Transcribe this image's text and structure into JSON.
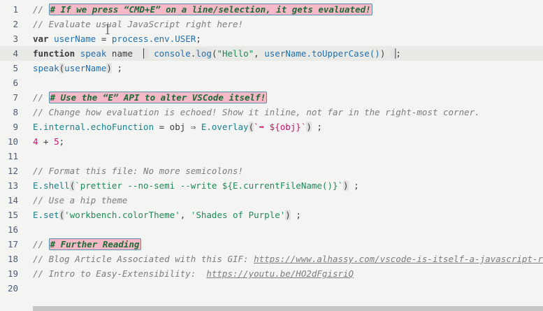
{
  "line_numbers": [
    "1",
    "2",
    "3",
    "4",
    "5",
    "6",
    "7",
    "8",
    "9",
    "10",
    "11",
    "12",
    "13",
    "14",
    "15",
    "16",
    "17",
    "18",
    "19",
    "20"
  ],
  "lines": {
    "l1": {
      "prefix": "// ",
      "heading": "# If we press “CMD+E” on a line/selection, it gets evaluated!"
    },
    "l2": {
      "text": "// Evaluate usual JavaScript right here!"
    },
    "l3": {
      "kw": "var",
      "name": "userName",
      "op": " = ",
      "proc": "process.env.USER",
      "end": ";"
    },
    "l4": {
      "kw": "function",
      "fn": "speak",
      "param": "name",
      "obj": "console",
      "method": "log",
      "arg1": "\"Hello\"",
      "arg2": "userName.toUpperCase()",
      "end": ";"
    },
    "l5": {
      "fn": "speak",
      "arg": "userName",
      "end": ";"
    },
    "l7": {
      "prefix": "// ",
      "heading": "# Use the “E” API to alter VSCode itself!"
    },
    "l8": {
      "text": "// Change how evaluation is echoed! Show it inline, not far in the right-most corner."
    },
    "l9": {
      "a": "E.internal.echoFunction",
      "b": " = obj ⇒ ",
      "c": "E.overlay",
      "d": "`➡ ${obj}`",
      "end": ";"
    },
    "l10": {
      "a": "4",
      "op": " + ",
      "b": "5",
      "end": ";"
    },
    "l12": {
      "text": "// Format this file: No more semicolons!"
    },
    "l13": {
      "a": "E.shell",
      "b": "`prettier --no-semi --write ${E.currentFileName()}`",
      "end": ";"
    },
    "l14": {
      "text": "// Use a hip theme"
    },
    "l15": {
      "a": "E.set",
      "b": "'workbench.colorTheme'",
      "c": ", ",
      "d": "'Shades of Purple'",
      "end": ";"
    },
    "l17": {
      "prefix": "// ",
      "heading": "# Further Reading"
    },
    "l18": {
      "prefix": "// Blog Article Associated with this GIF: ",
      "url": "https://www.alhassy.com/vscode-is-itself-a-javascript-repl"
    },
    "l19": {
      "prefix": "// Intro to Easy-Extensibility:  ",
      "url": "https://youtu.be/HO2dFgisriQ"
    }
  },
  "colors": {
    "background": "#f4f4f3",
    "heading_bg": "#f7b8c7",
    "heading_fg": "#1a6b36",
    "current_line": "#e9e9e6"
  },
  "icons": {
    "cursor": "text-cursor-icon"
  }
}
